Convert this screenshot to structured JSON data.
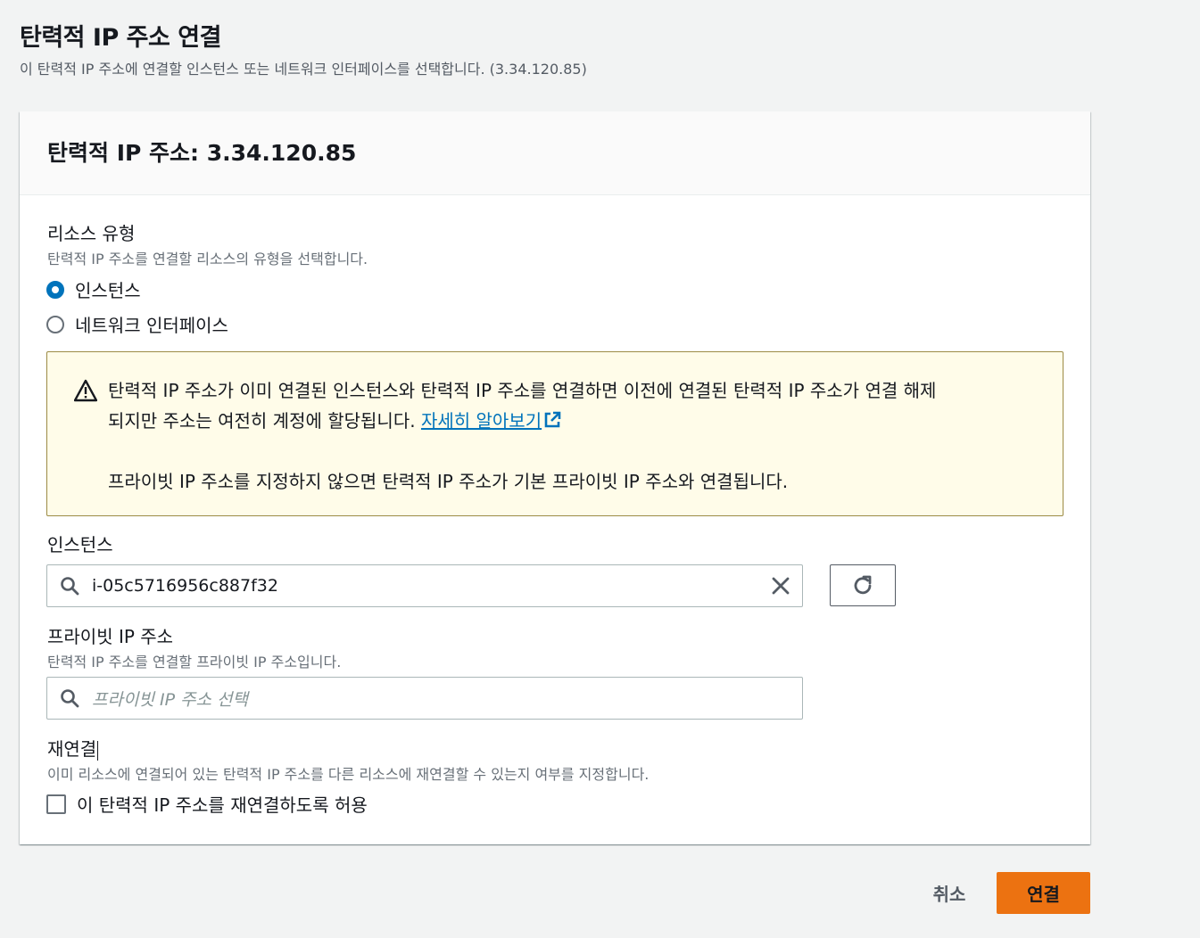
{
  "page": {
    "title": "탄력적 IP 주소 연결",
    "description": "이 탄력적 IP 주소에 연결할 인스턴스 또는 네트워크 인터페이스를 선택합니다. (3.34.120.85)"
  },
  "card": {
    "title": "탄력적 IP 주소: 3.34.120.85"
  },
  "resource_type": {
    "label": "리소스 유형",
    "description": "탄력적 IP 주소를 연결할 리소스의 유형을 선택합니다.",
    "options": [
      {
        "label": "인스턴스",
        "selected": true
      },
      {
        "label": "네트워크 인터페이스",
        "selected": false
      }
    ]
  },
  "alert": {
    "icon": "warning-icon",
    "text_line1": "탄력적 IP 주소가 이미 연결된 인스턴스와 탄력적 IP 주소를 연결하면 이전에 연결된 탄력적 IP 주소가 연결 해제",
    "text_line2": "되지만 주소는 여전히 계정에 할당됩니다. ",
    "link_label": "자세히 알아보기",
    "text_line3": "프라이빗 IP 주소를 지정하지 않으면 탄력적 IP 주소가 기본 프라이빗 IP 주소와 연결됩니다."
  },
  "instance": {
    "label": "인스턴스",
    "value": "i-05c5716956c887f32"
  },
  "private_ip": {
    "label": "프라이빗 IP 주소",
    "description": "탄력적 IP 주소를 연결할 프라이빗 IP 주소입니다.",
    "placeholder": "프라이빗 IP 주소 선택"
  },
  "reassociation": {
    "label": "재연결",
    "description": "이미 리소스에 연결되어 있는 탄력적 IP 주소를 다른 리소스에 재연결할 수 있는지 여부를 지정합니다.",
    "checkbox_label": "이 탄력적 IP 주소를 재연결하도록 허용",
    "checked": false
  },
  "footer": {
    "cancel_label": "취소",
    "submit_label": "연결"
  },
  "colors": {
    "accent": "#0073bb",
    "primary_button": "#ec7211",
    "warning_bg": "#fffce9"
  }
}
